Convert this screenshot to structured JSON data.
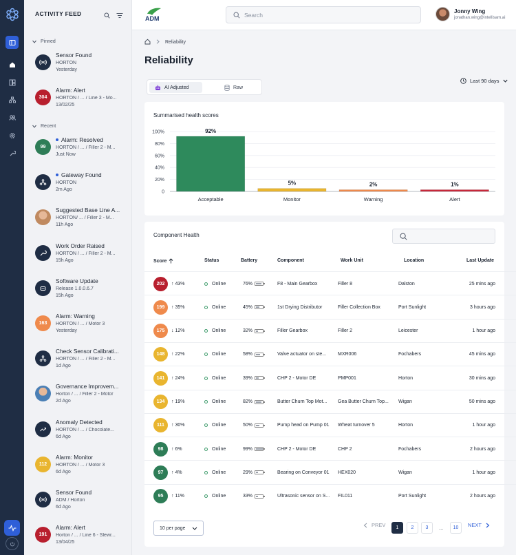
{
  "feed": {
    "title": "ACTIVITY FEED",
    "pinned_label": "Pinned",
    "recent_label": "Recent",
    "pinned": [
      {
        "title": "Sensor Found",
        "sub": "HORTON",
        "time": "Yesterday",
        "badge": "",
        "color": "#1f2d44",
        "icon": "signal-icon"
      },
      {
        "title": "Alarm: Alert",
        "sub": "HORTON / ... / Line 3 - Mo...",
        "time": "13/02/25",
        "badge": "304",
        "color": "#b81f2e",
        "icon": ""
      }
    ],
    "recent": [
      {
        "title": "Alarm: Resolved",
        "sub": "HORTON / ... / Filler 2 - M...",
        "time": "Just Now",
        "badge": "99",
        "color": "#2e7d57",
        "icon": "",
        "unread": true
      },
      {
        "title": "Gateway Found",
        "sub": "HORTON",
        "time": "2m Ago",
        "badge": "",
        "color": "#1f2d44",
        "icon": "gateway-icon",
        "unread": true
      },
      {
        "title": "Suggested Base Line A...",
        "sub": "HORTON/ ... / Filler 2 - M...",
        "time": "11h Ago",
        "badge": "",
        "color": "#c08a60",
        "icon": "user-photo-icon"
      },
      {
        "title": "Work Order Raised",
        "sub": "HORTON / ... / Filler 2 - M...",
        "time": "15h Ago",
        "badge": "",
        "color": "#1f2d44",
        "icon": "wrench-icon"
      },
      {
        "title": "Software Update",
        "sub": "Release 1.0.0.6.7",
        "time": "15h Ago",
        "badge": "",
        "color": "#1f2d44",
        "icon": "robot-icon"
      },
      {
        "title": "Alarm: Warning",
        "sub": "HORTON / ... / Motor 3",
        "time": "Yesterday",
        "badge": "163",
        "color": "#ef8a4c",
        "icon": ""
      },
      {
        "title": "Check Sensor Calibrati...",
        "sub": "HORTON / ... / Filler 2 - M...",
        "time": "1d Ago",
        "badge": "",
        "color": "#1f2d44",
        "icon": "gateway-icon"
      },
      {
        "title": "Governance Improvem...",
        "sub": "Horton / ... / Filler 2 - Motor",
        "time": "2d Ago",
        "badge": "",
        "color": "#4a7fb5",
        "icon": "user-photo-icon"
      },
      {
        "title": "Anomaly Detected",
        "sub": "HORTON / ... / Chocolate...",
        "time": "6d Ago",
        "badge": "",
        "color": "#1f2d44",
        "icon": "trend-icon"
      },
      {
        "title": "Alarm: Monitor",
        "sub": "HORTON / ... / Motor 3",
        "time": "6d Ago",
        "badge": "112",
        "color": "#e9b52f",
        "icon": ""
      },
      {
        "title": "Sensor Found",
        "sub": "ADM / Horton",
        "time": "6d Ago",
        "badge": "",
        "color": "#1f2d44",
        "icon": "signal-icon"
      },
      {
        "title": "Alarm: Alert",
        "sub": "Horton / ... / Line 6 - Slewr...",
        "time": "13/04/25",
        "badge": "191",
        "color": "#b81f2e",
        "icon": ""
      }
    ]
  },
  "topbar": {
    "logo_text": "ADM",
    "search_placeholder": "Search",
    "user_name": "Jonny Wing",
    "user_email": "jonathan.wing@intellisam.ai"
  },
  "breadcrumb": {
    "current": "Reliability"
  },
  "page_title": "Reliability",
  "toggle": {
    "ai_label": "AI Adjusted",
    "raw_label": "Raw"
  },
  "date_range": "Last 90 days",
  "health_card": {
    "title": "Summarised health scores"
  },
  "chart_data": {
    "type": "bar",
    "categories": [
      "Acceptable",
      "Monitor",
      "Warning",
      "Alert"
    ],
    "values": [
      92,
      5,
      2,
      1
    ],
    "value_labels": [
      "92%",
      "5%",
      "2%",
      "1%"
    ],
    "colors": [
      "#2e8a5c",
      "#e9b52f",
      "#ef8a4c",
      "#c8283a"
    ],
    "ylim": [
      0,
      100
    ],
    "yticks": [
      "0",
      "20%",
      "40%",
      "60%",
      "80%",
      "100%"
    ],
    "grid": true
  },
  "component_card": {
    "title": "Component Health"
  },
  "table": {
    "headers": [
      "Score",
      "Status",
      "Battery",
      "Component",
      "Work Unit",
      "Location",
      "Last Update"
    ],
    "rows": [
      {
        "score": "202",
        "color": "#b81f2e",
        "trend": "↑",
        "delta": "43%",
        "status": "Online",
        "battery": "76%",
        "battery_level": 0.76,
        "component": "F8 - Main Gearbox",
        "unit": "Filler 8",
        "location": "Dalston",
        "updated": "25 mins ago"
      },
      {
        "score": "199",
        "color": "#ef8a4c",
        "trend": "↑",
        "delta": "35%",
        "status": "Online",
        "battery": "45%",
        "battery_level": 0.45,
        "component": "1st Drying Distributor",
        "unit": "Filler Collection Box",
        "location": "Port Sunlight",
        "updated": "3 hours ago"
      },
      {
        "score": "175",
        "color": "#ef8a4c",
        "trend": "↓",
        "delta": "12%",
        "status": "Online",
        "battery": "32%",
        "battery_level": 0.32,
        "component": "Filler Gearbox",
        "unit": "Filler 2",
        "location": "Leicester",
        "updated": "1 hour ago"
      },
      {
        "score": "148",
        "color": "#e9b52f",
        "trend": "↑",
        "delta": "22%",
        "status": "Online",
        "battery": "58%",
        "battery_level": 0.58,
        "component": "Valve actuator on ste...",
        "unit": "MXR006",
        "location": "Fochabers",
        "updated": "45 mins ago"
      },
      {
        "score": "141",
        "color": "#e9b52f",
        "trend": "↑",
        "delta": "24%",
        "status": "Online",
        "battery": "39%",
        "battery_level": 0.39,
        "component": "CHP 2 - Motor DE",
        "unit": "PMP001",
        "location": "Horton",
        "updated": "30 mins ago"
      },
      {
        "score": "134",
        "color": "#e9b52f",
        "trend": "↑",
        "delta": "19%",
        "status": "Online",
        "battery": "82%",
        "battery_level": 0.82,
        "component": "Butter Churn Top Mot...",
        "unit": "Gea Butter Churn Top...",
        "location": "Wigan",
        "updated": "50 mins ago"
      },
      {
        "score": "111",
        "color": "#e9b52f",
        "trend": "↑",
        "delta": "30%",
        "status": "Online",
        "battery": "50%",
        "battery_level": 0.5,
        "component": "Pump head on Pump 01",
        "unit": "Wheat turnover 5",
        "location": "Horton",
        "updated": "1 hour ago"
      },
      {
        "score": "98",
        "color": "#2e7d57",
        "trend": "↑",
        "delta": "6%",
        "status": "Online",
        "battery": "99%",
        "battery_level": 0.99,
        "component": "CHP 2 - Motor DE",
        "unit": "CHP 2",
        "location": "Fochabers",
        "updated": "2 hours ago"
      },
      {
        "score": "97",
        "color": "#2e7d57",
        "trend": "↑",
        "delta": "4%",
        "status": "Online",
        "battery": "29%",
        "battery_level": 0.29,
        "component": "Bearing on Conveyor 01",
        "unit": "HEX020",
        "location": "Wigan",
        "updated": "1 hour ago"
      },
      {
        "score": "95",
        "color": "#2e7d57",
        "trend": "↑",
        "delta": "11%",
        "status": "Online",
        "battery": "33%",
        "battery_level": 0.33,
        "component": "Ultrasonic sensor on S...",
        "unit": "FIL011",
        "location": "Port Sunlight",
        "updated": "2 hours ago"
      }
    ]
  },
  "pagination": {
    "per_page": "10 per page",
    "prev": "PREV",
    "next": "NEXT",
    "pages": [
      "1",
      "2",
      "3",
      "...",
      "10"
    ],
    "current": "1"
  }
}
